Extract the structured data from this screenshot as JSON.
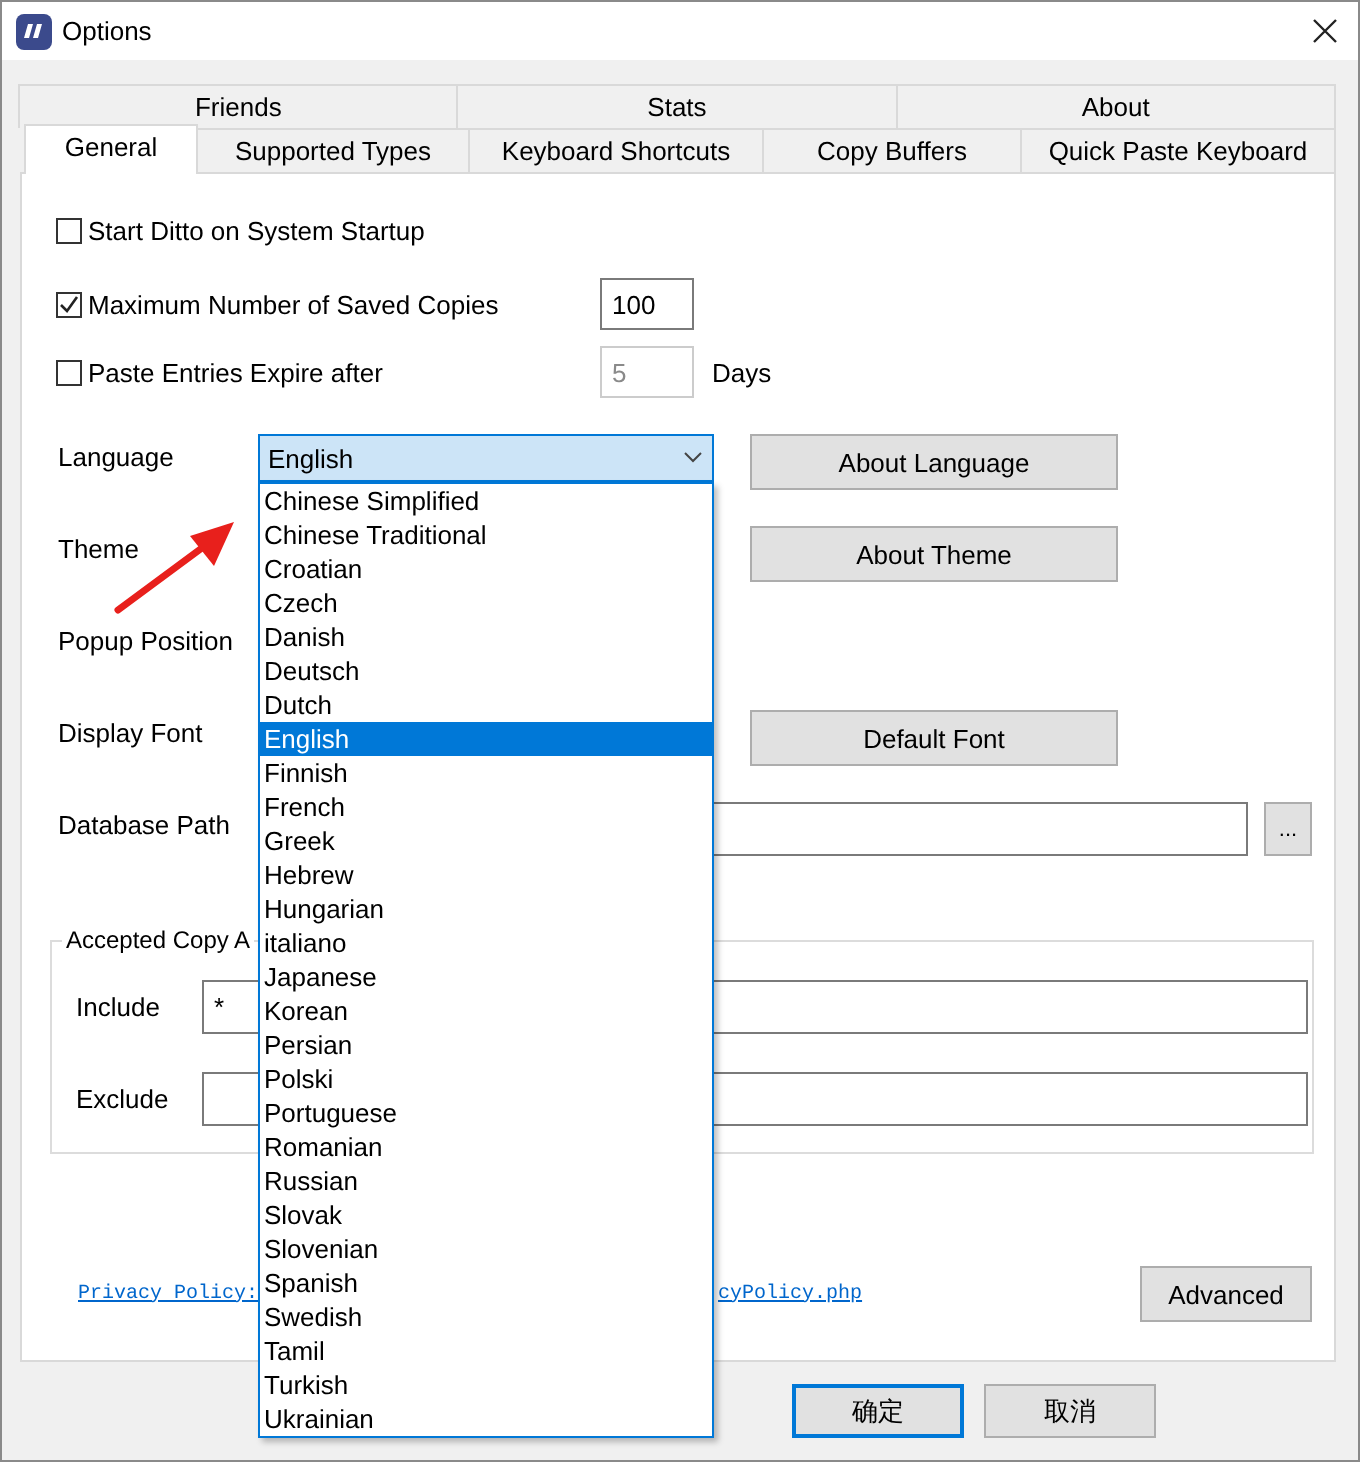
{
  "window": {
    "title": "Options"
  },
  "tab_rows": [
    {
      "tabs": [
        {
          "label": "Friends",
          "selected": false
        },
        {
          "label": "Stats",
          "selected": false
        },
        {
          "label": "About",
          "selected": false
        }
      ]
    },
    {
      "tabs": [
        {
          "label": "General",
          "selected": true
        },
        {
          "label": "Supported Types",
          "selected": false
        },
        {
          "label": "Keyboard Shortcuts",
          "selected": false
        },
        {
          "label": "Copy Buffers",
          "selected": false
        },
        {
          "label": "Quick Paste Keyboard",
          "selected": false
        }
      ]
    }
  ],
  "checkboxes": [
    {
      "label": "Start Ditto on System Startup",
      "checked": false
    },
    {
      "label": "Maximum Number of Saved Copies",
      "checked": true,
      "field": {
        "value": "100",
        "disabled": false
      }
    },
    {
      "label": "Paste Entries Expire after",
      "checked": false,
      "field": {
        "value": "5",
        "disabled": true
      },
      "unit": "Days"
    }
  ],
  "settings": [
    {
      "label": "Language",
      "kind": "combo",
      "value": "English",
      "button": "About Language"
    },
    {
      "label": "Theme",
      "kind": "plain",
      "button": "About Theme"
    },
    {
      "label": "Popup Position",
      "kind": "plain"
    },
    {
      "label": "Display Font",
      "kind": "plain",
      "button": "Default Font"
    },
    {
      "label": "Database Path",
      "kind": "path",
      "browse": "..."
    }
  ],
  "copy_filter": {
    "title": "Accepted Copy A",
    "include": {
      "label": "Include",
      "value": "*"
    },
    "exclude": {
      "label": "Exclude"
    }
  },
  "privacy_link": {
    "left": "Privacy Policy:",
    "right": "cyPolicy.php"
  },
  "advanced_button": "Advanced",
  "buttons": [
    {
      "label": "确定",
      "default": true
    },
    {
      "label": "取消",
      "default": false
    }
  ],
  "language_dropdown": {
    "items": [
      {
        "label": "Chinese Simplified",
        "selected": false
      },
      {
        "label": "Chinese Traditional",
        "selected": false
      },
      {
        "label": "Croatian",
        "selected": false
      },
      {
        "label": "Czech",
        "selected": false
      },
      {
        "label": "Danish",
        "selected": false
      },
      {
        "label": "Deutsch",
        "selected": false
      },
      {
        "label": "Dutch",
        "selected": false
      },
      {
        "label": "English",
        "selected": true
      },
      {
        "label": "Finnish",
        "selected": false
      },
      {
        "label": "French",
        "selected": false
      },
      {
        "label": "Greek",
        "selected": false
      },
      {
        "label": "Hebrew",
        "selected": false
      },
      {
        "label": "Hungarian",
        "selected": false
      },
      {
        "label": "italiano",
        "selected": false
      },
      {
        "label": "Japanese",
        "selected": false
      },
      {
        "label": "Korean",
        "selected": false
      },
      {
        "label": "Persian",
        "selected": false
      },
      {
        "label": "Polski",
        "selected": false
      },
      {
        "label": "Portuguese",
        "selected": false
      },
      {
        "label": "Romanian",
        "selected": false
      },
      {
        "label": "Russian",
        "selected": false
      },
      {
        "label": "Slovak",
        "selected": false
      },
      {
        "label": "Slovenian",
        "selected": false
      },
      {
        "label": "Spanish",
        "selected": false
      },
      {
        "label": "Swedish",
        "selected": false
      },
      {
        "label": "Tamil",
        "selected": false
      },
      {
        "label": "Turkish",
        "selected": false
      },
      {
        "label": "Ukrainian",
        "selected": false
      }
    ]
  }
}
